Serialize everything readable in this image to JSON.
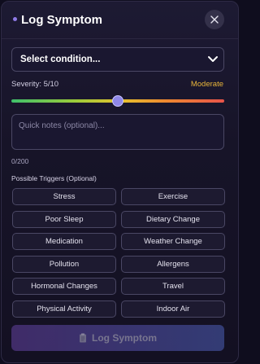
{
  "header": {
    "title": "Log Symptom",
    "accent_color": "#8f7ae6"
  },
  "condition_select": {
    "selected_label": "Select condition..."
  },
  "severity": {
    "label": "Severity: 5/10",
    "value": 5,
    "max": 10,
    "level_text": "Moderate",
    "level_color": "#e8b43a"
  },
  "notes": {
    "placeholder": "Quick notes (optional)...",
    "counter": "0/200"
  },
  "triggers": {
    "label": "Possible Triggers (Optional)",
    "items": [
      "Stress",
      "Exercise",
      "Poor Sleep",
      "Dietary Change",
      "Medication",
      "Weather Change",
      "Pollution",
      "Allergens",
      "Hormonal Changes",
      "Travel",
      "Physical Activity",
      "Indoor Air"
    ]
  },
  "submit": {
    "label": "Log Symptom",
    "icon": "clipboard-icon"
  },
  "icons": {
    "close": "close-icon",
    "dropdown": "chevron-down-icon"
  }
}
